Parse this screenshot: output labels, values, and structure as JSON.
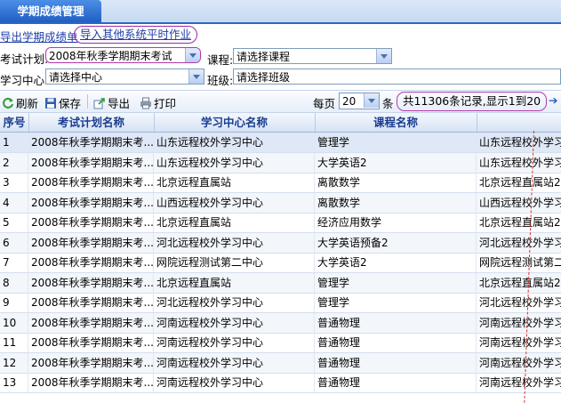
{
  "tab": {
    "label": "学期成绩管理"
  },
  "links": {
    "export_scores": "导出学期成绩单",
    "import_homework": "导入其他系统平时作业"
  },
  "filters": {
    "exam_plan_label": "考试计划:",
    "exam_plan_value": "2008年秋季学期期末考试",
    "course_label": "课程:",
    "course_value": "请选择课程",
    "center_label": "学习中心:",
    "center_value": "请选择中心",
    "class_label": "班级:",
    "class_value": "请选择班级"
  },
  "toolbar": {
    "refresh": "刷新",
    "save": "保存",
    "export": "导出",
    "print": "打印",
    "per_page_label": "每页",
    "per_page_value": "20",
    "per_page_unit": "条",
    "summary": "共11306条记录,显示1到20"
  },
  "table": {
    "headers": [
      "序号",
      "考试计划名称",
      "学习中心名称",
      "课程名称",
      ""
    ],
    "rows": [
      [
        "1",
        "2008年秋季学期期末考...",
        "山东远程校外学习中心",
        "管理学",
        "山东远程校外学习"
      ],
      [
        "2",
        "2008年秋季学期期末考...",
        "山东远程校外学习中心",
        "大学英语2",
        "山东远程校外学习"
      ],
      [
        "3",
        "2008年秋季学期期末考...",
        "北京远程直属站",
        "离散数学",
        "北京远程直属站2"
      ],
      [
        "4",
        "2008年秋季学期期末考...",
        "山西远程校外学习中心",
        "离散数学",
        "山西远程校外学习"
      ],
      [
        "5",
        "2008年秋季学期期末考...",
        "北京远程直属站",
        "经济应用数学",
        "北京远程直属站2"
      ],
      [
        "6",
        "2008年秋季学期期末考...",
        "河北远程校外学习中心",
        "大学英语预备2",
        "河北远程校外学习"
      ],
      [
        "7",
        "2008年秋季学期期末考...",
        "网院远程测试第二中心",
        "大学英语2",
        "网院远程测试第二"
      ],
      [
        "8",
        "2008年秋季学期期末考...",
        "北京远程直属站",
        "管理学",
        "北京远程直属站2"
      ],
      [
        "9",
        "2008年秋季学期期末考...",
        "河北远程校外学习中心",
        "管理学",
        "河北远程校外学习"
      ],
      [
        "10",
        "2008年秋季学期期末考...",
        "河南远程校外学习中心",
        "普通物理",
        "河南远程校外学习"
      ],
      [
        "11",
        "2008年秋季学期期末考...",
        "河南远程校外学习中心",
        "普通物理",
        "河南远程校外学习"
      ],
      [
        "12",
        "2008年秋季学期期末考...",
        "河南远程校外学习中心",
        "普通物理",
        "河南远程校外学习"
      ],
      [
        "13",
        "2008年秋季学期期末考...",
        "河南远程校外学习中心",
        "普通物理",
        "河南远程校外学习"
      ]
    ]
  },
  "icons": [
    "refresh-icon",
    "save-icon",
    "export-icon",
    "print-icon",
    "next-page-icon"
  ],
  "colors": {
    "accent": "#1f5fc4",
    "highlight_ring": "#b03aa8",
    "link": "#1f3ea8"
  }
}
